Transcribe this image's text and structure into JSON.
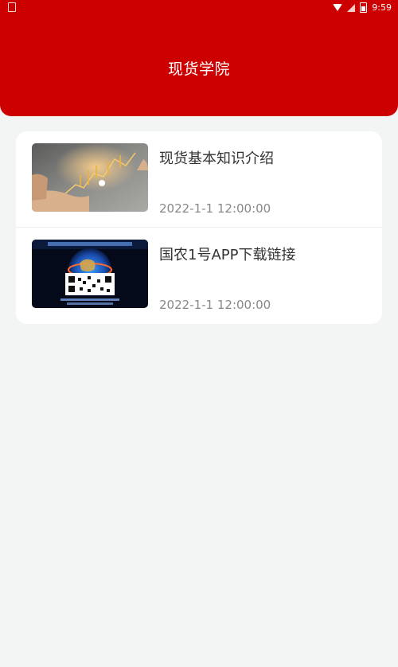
{
  "status_bar": {
    "time": "9:59",
    "icons": [
      "sim-icon",
      "wifi-icon",
      "signal-icon",
      "battery-icon"
    ]
  },
  "header": {
    "title": "现货学院",
    "background_color": "#cc0000"
  },
  "articles": [
    {
      "title": "现货基本知识介绍",
      "date": "2022-1-1 12:00:00",
      "thumbnail": "hand-with-financial-chart-graphic"
    },
    {
      "title": "国农1号APP下载链接",
      "date": "2022-1-1 12:00:00",
      "thumbnail": "qr-code-poster-with-globe"
    }
  ]
}
